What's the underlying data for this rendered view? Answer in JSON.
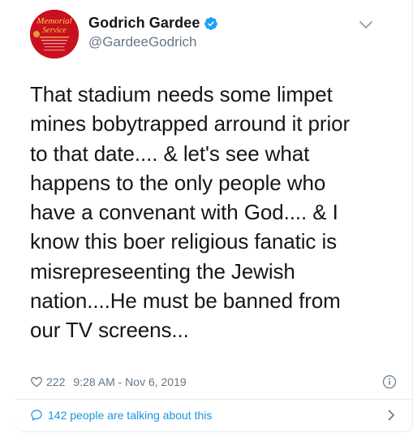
{
  "author": {
    "display_name": "Godrich Gardee",
    "handle": "@GardeeGodrich",
    "verified": true,
    "avatar_text": "Memorial Service"
  },
  "tweet": {
    "text": "That stadium needs some limpet\nmines bobytrapped arround it prior\nto that date.... & let's see what\nhappens to the only people who\nhave a convenant with God.... & I\nknow this boer religious fanatic is\nmisrepreseenting the Jewish\nnation....He must be banned from\nour TV screens...",
    "likes": "222",
    "timestamp": "9:28 AM - Nov 6, 2019"
  },
  "footer": {
    "talking_label": "142 people are talking about this"
  },
  "icons": {
    "verified": "verified-badge-icon",
    "menu": "chevron-down-icon",
    "like": "heart-icon",
    "info": "info-icon",
    "reply": "speech-bubble-icon",
    "more": "chevron-right-icon"
  },
  "colors": {
    "accent": "#1b95e0",
    "text": "#14171a",
    "muted": "#657786",
    "border": "#e6ecf0"
  }
}
